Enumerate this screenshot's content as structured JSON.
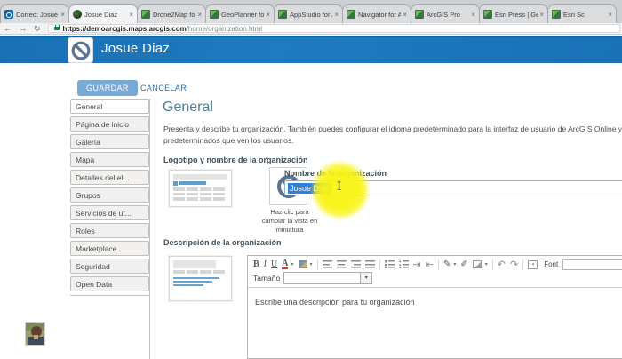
{
  "browser": {
    "tabs": [
      {
        "label": "Correo: Josue D",
        "icon": "outlook",
        "close": "×"
      },
      {
        "label": "Josue Diaz",
        "icon": "globe",
        "active": true,
        "close": "×"
      },
      {
        "label": "Drone2Map fo",
        "icon": "esri",
        "close": "×"
      },
      {
        "label": "GeoPlanner fo",
        "icon": "esri",
        "close": "×"
      },
      {
        "label": "AppStudio for A",
        "icon": "esri",
        "close": "×"
      },
      {
        "label": "Navigator for A",
        "icon": "esri",
        "close": "×"
      },
      {
        "label": "ArcGIS Pro",
        "icon": "esri",
        "close": "×"
      },
      {
        "label": "Esri Press | Get",
        "icon": "esri",
        "close": "×"
      },
      {
        "label": "Esri Sc",
        "icon": "esri",
        "close": "×"
      }
    ],
    "nav": {
      "back": "←",
      "forward": "→",
      "refresh": "↻"
    },
    "url_host": "https://demoarcgis.maps.arcgis.com",
    "url_path": "/home/organization.html"
  },
  "banner": {
    "org_name": "Josue Diaz"
  },
  "actions": {
    "save": "GUARDAR",
    "cancel": "CANCELAR"
  },
  "sidebar": {
    "items": [
      {
        "label": "General",
        "active": true
      },
      {
        "label": "Página de inicio"
      },
      {
        "label": "Galería"
      },
      {
        "label": "Mapa"
      },
      {
        "label": "Detalles del el..."
      },
      {
        "label": "Grupos"
      },
      {
        "label": "Servicios de ut..."
      },
      {
        "label": "Roles"
      },
      {
        "label": "Marketplace"
      },
      {
        "label": "Seguridad"
      },
      {
        "label": "Open Data"
      }
    ]
  },
  "main": {
    "title": "General",
    "intro": "Presenta y describe tu organización. También puedes configurar el idioma predeterminado para la interfaz de usuario de ArcGIS Online y los mapas base predeterminados que ven los usuarios.",
    "logo_section": {
      "heading": "Logotipo y nombre de la organización",
      "thumb_caption": "Haz clic para cambiar la vista en miniatura",
      "name_label": "Nombre de la organización",
      "name_value": "Josue Diaz"
    },
    "desc_section": {
      "heading": "Descripción de la organización",
      "placeholder": "Escribe una descripción para tu organización"
    }
  },
  "editor": {
    "size_label": "Tamaño",
    "font_label": "Font",
    "icons": {
      "bold": "B",
      "italic": "I",
      "underline": "U",
      "font_color": "A",
      "caret": "▾",
      "indent": "⇥",
      "outdent": "⇤",
      "link": "✎",
      "unlink": "✐",
      "undo": "↶",
      "redo": "↷",
      "source": "‹›"
    }
  },
  "colors": {
    "banner_blue": "#1b73b9",
    "save_button": "#78a9d6",
    "cancel_link": "#2f6b9e",
    "selection_blue": "#2f80d9",
    "highlight_yellow": "#f8f414",
    "esri_green": "#3f9c35",
    "outlook_blue": "#1266a7",
    "padlock_green": "#0b8043"
  }
}
